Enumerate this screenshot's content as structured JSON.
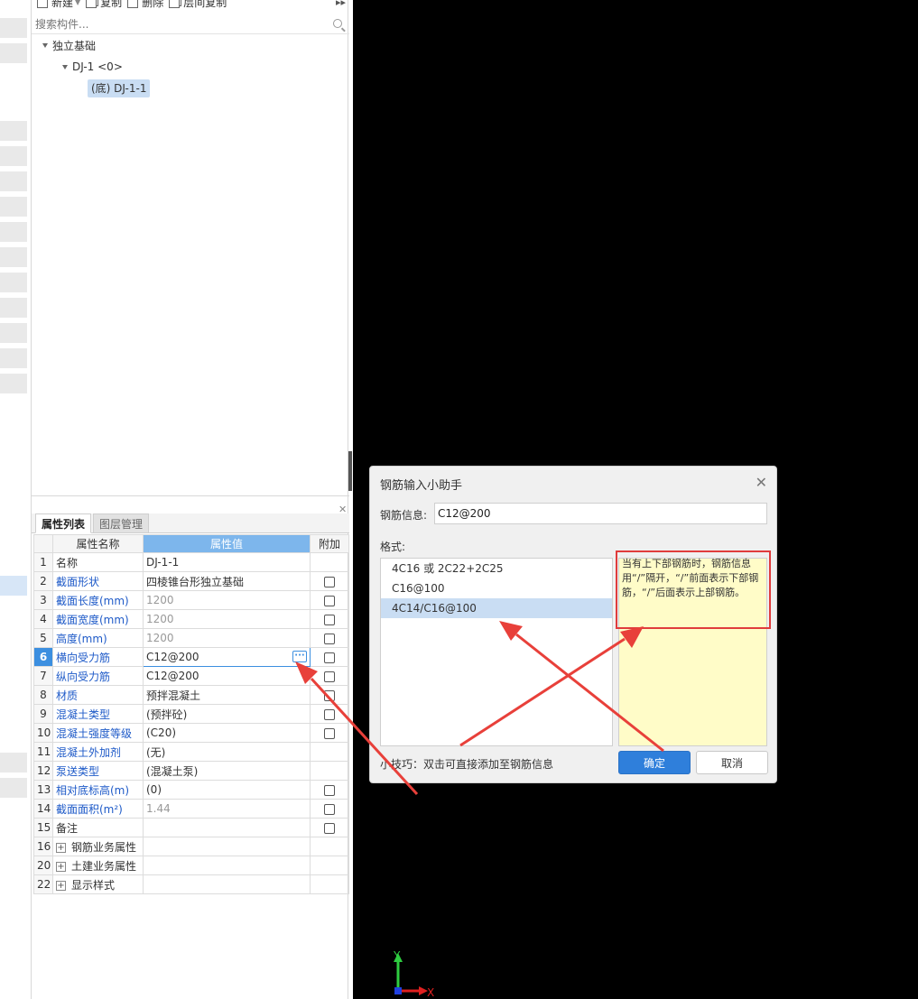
{
  "toolbar": {
    "new_label": "新建",
    "copy_label": "复制",
    "delete_label": "删除",
    "floor_copy_label": "层间复制"
  },
  "search": {
    "placeholder": "搜索构件..."
  },
  "tree": {
    "root": "独立基础",
    "child": "DJ-1 <0>",
    "leaf": "(底) DJ-1-1"
  },
  "tabs": {
    "properties": "属性列表",
    "layers": "图层管理"
  },
  "table": {
    "headers": {
      "name": "属性名称",
      "value": "属性值",
      "extra": "附加"
    },
    "rows": [
      {
        "num": "1",
        "name": "名称",
        "value": "DJ-1-1"
      },
      {
        "num": "2",
        "name": "截面形状",
        "value": "四棱锥台形独立基础"
      },
      {
        "num": "3",
        "name": "截面长度(mm)",
        "value": "1200"
      },
      {
        "num": "4",
        "name": "截面宽度(mm)",
        "value": "1200"
      },
      {
        "num": "5",
        "name": "高度(mm)",
        "value": "1200"
      },
      {
        "num": "6",
        "name": "横向受力筋",
        "value": "C12@200"
      },
      {
        "num": "7",
        "name": "纵向受力筋",
        "value": "C12@200"
      },
      {
        "num": "8",
        "name": "材质",
        "value": "预拌混凝土"
      },
      {
        "num": "9",
        "name": "混凝土类型",
        "value": "(预拌砼)"
      },
      {
        "num": "10",
        "name": "混凝土强度等级",
        "value": "(C20)"
      },
      {
        "num": "11",
        "name": "混凝土外加剂",
        "value": "(无)"
      },
      {
        "num": "12",
        "name": "泵送类型",
        "value": "(混凝土泵)"
      },
      {
        "num": "13",
        "name": "相对底标高(m)",
        "value": "(0)"
      },
      {
        "num": "14",
        "name": "截面面积(m²)",
        "value": "1.44"
      },
      {
        "num": "15",
        "name": "备注",
        "value": ""
      },
      {
        "num": "16",
        "name": "钢筋业务属性",
        "value": ""
      },
      {
        "num": "20",
        "name": "土建业务属性",
        "value": ""
      },
      {
        "num": "22",
        "name": "显示样式",
        "value": ""
      }
    ]
  },
  "dialog": {
    "title": "钢筋输入小助手",
    "info_label": "钢筋信息:",
    "info_value": "C12@200",
    "format_label": "格式:",
    "formats": [
      "4C16 或 2C22+2C25",
      "C16@100",
      "4C14/C16@100"
    ],
    "tip": "当有上下部钢筋时，钢筋信息用“/”隔开，“/”前面表示下部钢筋，“/”后面表示上部钢筋。",
    "hint": "小技巧：双击可直接添加至钢筋信息",
    "ok": "确定",
    "cancel": "取消",
    "close_glyph": "✕"
  },
  "axis": {
    "y": "Y",
    "x": "X"
  },
  "colors": {
    "accent": "#2f7fdb",
    "highlight": "#e03c3c",
    "tip_bg": "#fffcc8"
  }
}
